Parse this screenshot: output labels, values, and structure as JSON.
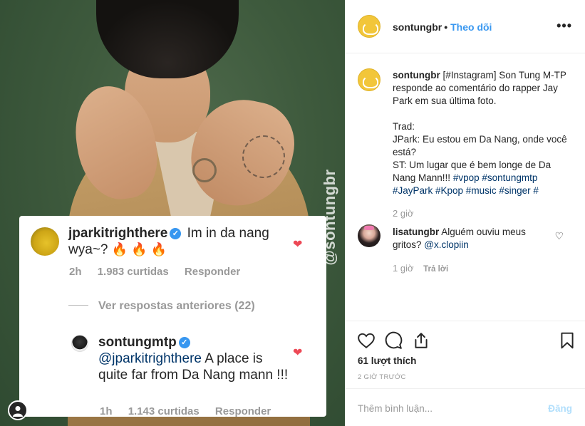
{
  "photo": {
    "watermark": "@sontungbr",
    "comment_card": {
      "comment1": {
        "username": "jparkitrighthere",
        "text": "Im in da nang wya~?",
        "emoji": "🔥 🔥 🔥",
        "time": "2h",
        "likes": "1.983 curtidas",
        "reply": "Responder"
      },
      "view_more": "Ver respostas anteriores (22)",
      "comment2": {
        "username": "sontungmtp",
        "mention": "@jparkitrighthere",
        "text": "A place is quite far from Da Nang mann !!!",
        "time": "1h",
        "likes": "1.143 curtidas",
        "reply": "Responder"
      }
    }
  },
  "header": {
    "username": "sontungbr",
    "dot": "•",
    "follow": "Theo dõi",
    "more": "•••"
  },
  "caption": {
    "username": "sontungbr",
    "line1": "[#Instagram] Son Tung M-TP responde ao comentário do rapper Jay Park em sua última foto.",
    "line2": "Trad:",
    "line3": "JPark: Eu estou em Da Nang, onde você está?",
    "line4": "ST: Um lugar que é bem longe de Da Nang Mann!!!",
    "tags": "#vpop #sontungmtp #JayPark #Kpop #music #singer #",
    "time": "2 giờ"
  },
  "comment": {
    "username": "lisatungbr",
    "text": "Alguém ouviu meus gritos?",
    "mention": "@x.clopiin",
    "time": "1 giờ",
    "reply": "Trả lời"
  },
  "footer": {
    "likes": "61 lượt thích",
    "post_time": "2 GIỜ TRƯỚC",
    "add_comment_placeholder": "Thêm bình luận...",
    "post_label": "Đăng"
  },
  "colors": {
    "accent": "#3897f0",
    "like_red": "#ed4956",
    "muted": "#999999",
    "post_disabled": "#b2dffc"
  }
}
